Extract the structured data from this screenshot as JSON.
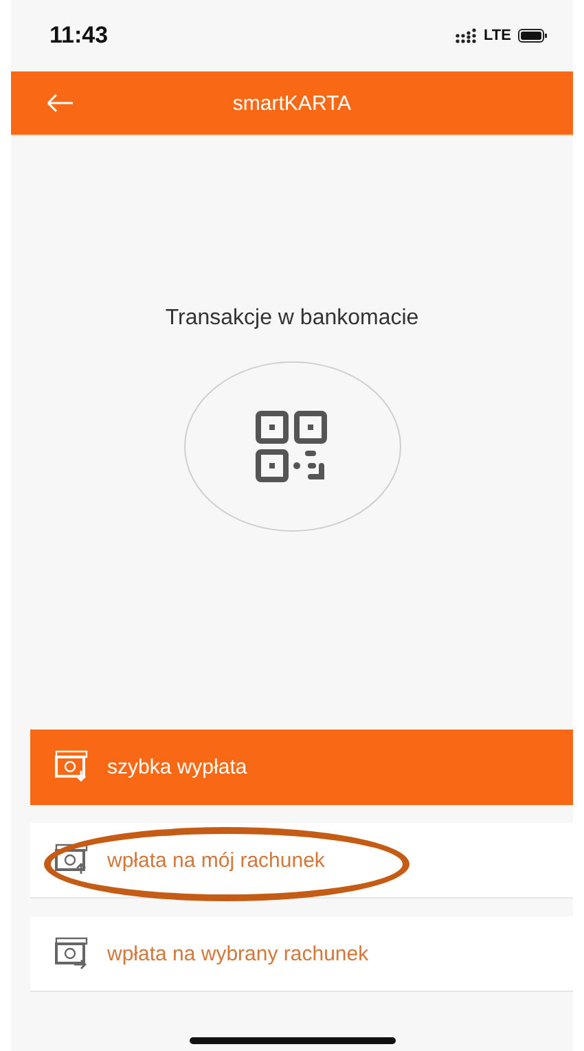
{
  "status_bar": {
    "time": "11:43",
    "network": "LTE"
  },
  "header": {
    "title": "smartKARTA"
  },
  "heading": "Transakcje w bankomacie",
  "options": [
    {
      "label": "szybka wypłata",
      "kind": "withdraw",
      "selected": true,
      "highlighted": false
    },
    {
      "label": "wpłata na mój rachunek",
      "kind": "deposit",
      "selected": false,
      "highlighted": true
    },
    {
      "label": "wpłata na wybrany rachunek",
      "kind": "transfer",
      "selected": false,
      "highlighted": false
    }
  ]
}
